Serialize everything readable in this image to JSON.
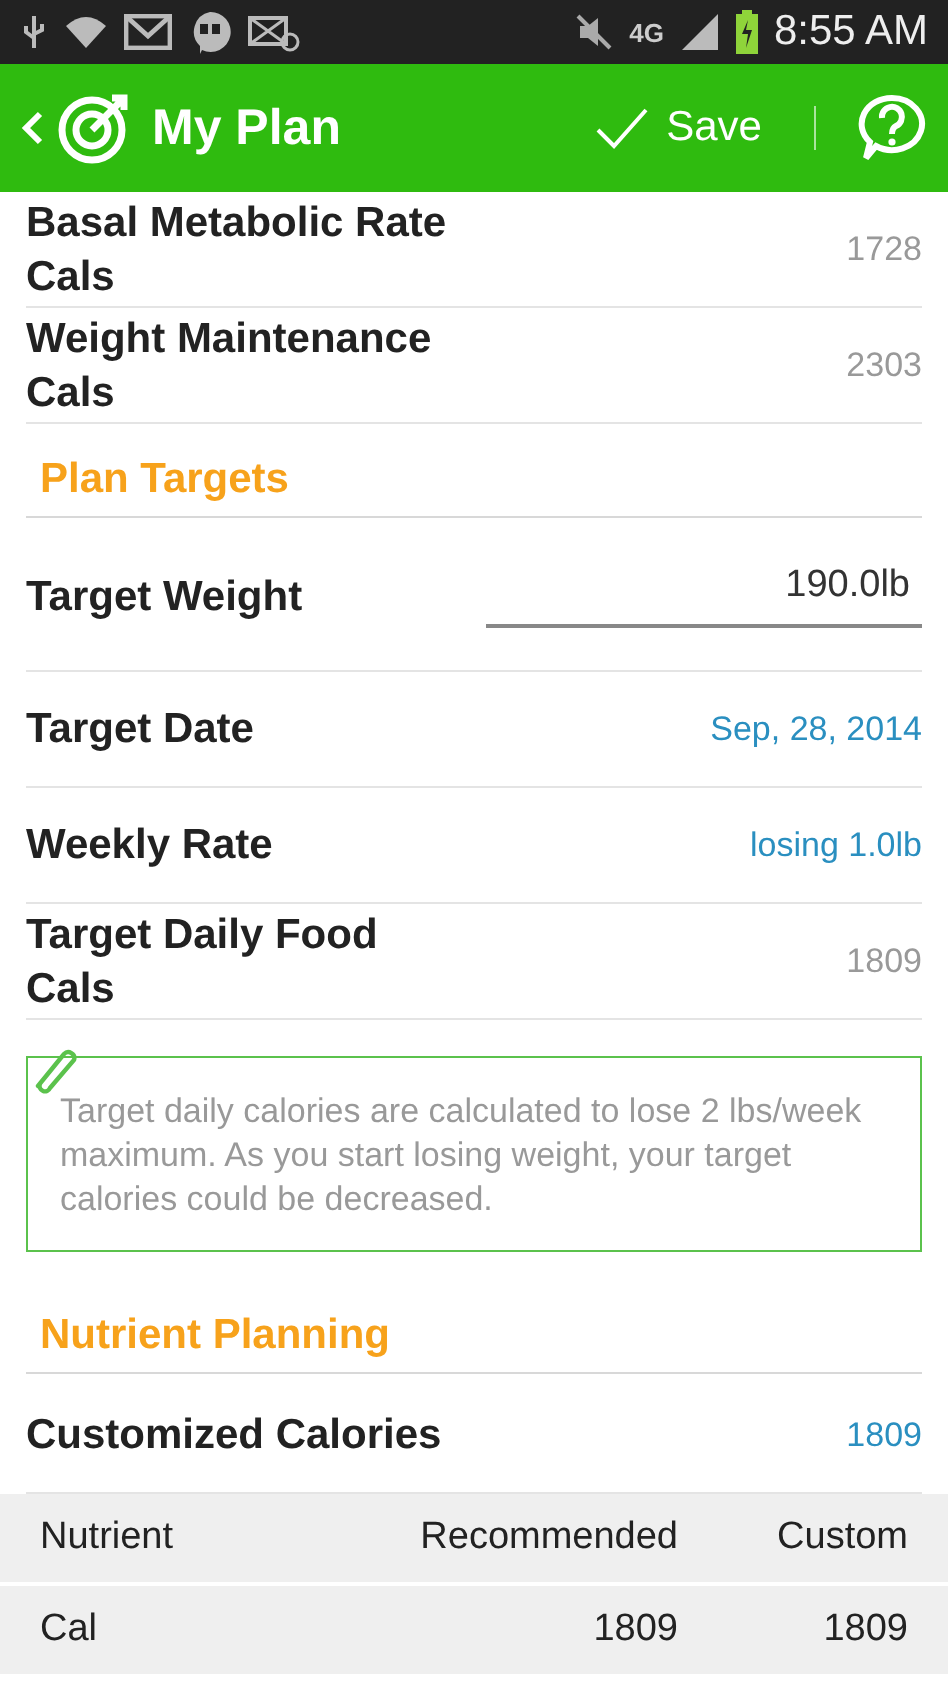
{
  "status_bar": {
    "network": "4G",
    "time": "8:55 AM"
  },
  "app_bar": {
    "title": "My Plan",
    "save": "Save"
  },
  "content": [
    {
      "kind": "row",
      "label": "Basal Metabolic Rate Cals",
      "value": "1728"
    },
    {
      "kind": "row",
      "label": "Weight Maintenance Cals",
      "value": "2303"
    },
    {
      "kind": "heading",
      "label": "Plan Targets"
    },
    {
      "kind": "field",
      "label": "Target Weight",
      "value": "190.0lb"
    },
    {
      "kind": "link",
      "label": "Target Date",
      "value": "Sep, 28, 2014"
    },
    {
      "kind": "link",
      "label": "Weekly Rate",
      "value": "losing 1.0lb"
    },
    {
      "kind": "row",
      "label": "Target Daily Food Cals",
      "value": "1809"
    },
    {
      "kind": "note",
      "label": "Target daily calories are calculated to lose 2 lbs/week maximum. As you start losing weight, your target calories could be decreased."
    },
    {
      "kind": "heading",
      "label": "Nutrient Planning"
    },
    {
      "kind": "link",
      "label": "Customized Calories",
      "value": "1809"
    }
  ],
  "table": {
    "columns": [
      "Nutrient",
      "Recommended",
      "Custom"
    ],
    "rows": [
      [
        "Cal",
        "1809",
        "1809"
      ]
    ]
  }
}
